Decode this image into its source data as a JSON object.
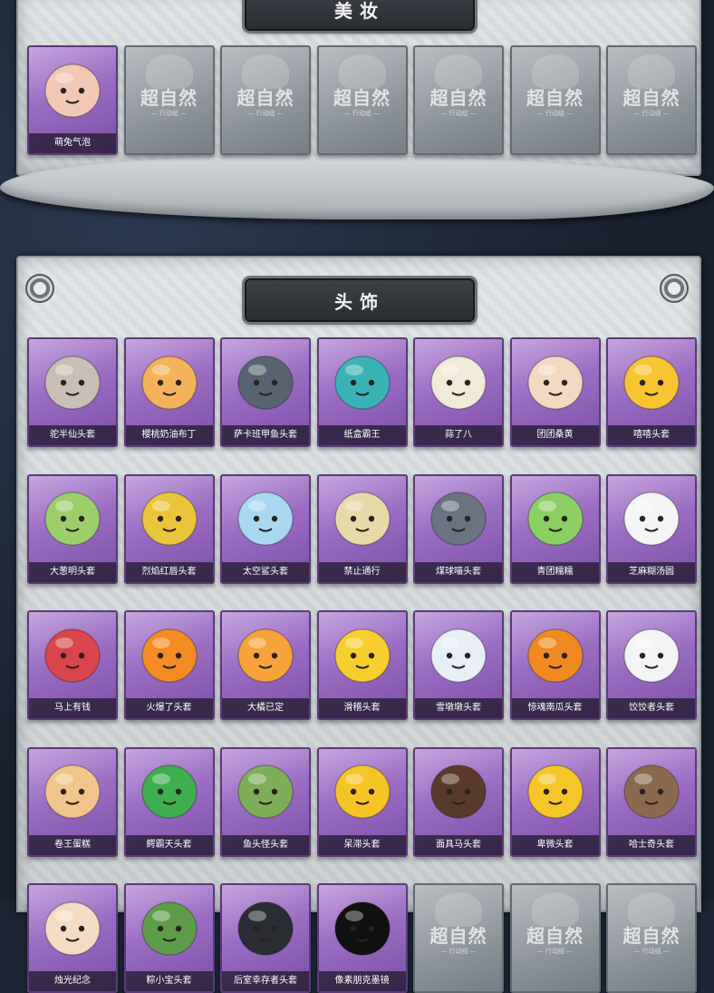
{
  "sections": {
    "makeup": {
      "title": "美妆",
      "items": [
        {
          "name": "萌兔气泡",
          "icon": "bunny-bubble-face-icon",
          "color": "#f2c7b3",
          "locked": false
        },
        {
          "name": "",
          "icon": "locked-placeholder-icon",
          "locked": true
        },
        {
          "name": "",
          "icon": "locked-placeholder-icon",
          "locked": true
        },
        {
          "name": "",
          "icon": "locked-placeholder-icon",
          "locked": true
        },
        {
          "name": "",
          "icon": "locked-placeholder-icon",
          "locked": true
        },
        {
          "name": "",
          "icon": "locked-placeholder-icon",
          "locked": true
        },
        {
          "name": "",
          "icon": "locked-placeholder-icon",
          "locked": true
        }
      ]
    },
    "headwear": {
      "title": "头饰",
      "items": [
        {
          "name": "驼半仙头套",
          "icon": "alpaca-sunglasses-head-icon",
          "color": "#c9bfb6",
          "locked": false
        },
        {
          "name": "樱桃奶油布丁",
          "icon": "cherry-pudding-head-icon",
          "color": "#f2b35a",
          "locked": false
        },
        {
          "name": "萨卡班甲鱼头套",
          "icon": "sacabambaspis-fish-head-icon",
          "color": "#5a6470",
          "locked": false
        },
        {
          "name": "纸盒霸王",
          "icon": "box-dinosaur-head-icon",
          "color": "#3ab3b7",
          "locked": false
        },
        {
          "name": "蒜了八",
          "icon": "garlic-head-icon",
          "color": "#f0ead8",
          "locked": false
        },
        {
          "name": "团团桑黄",
          "icon": "hamster-head-icon",
          "color": "#f4d8c0",
          "locked": false
        },
        {
          "name": "嘻嘻头套",
          "icon": "grinning-emoji-head-icon",
          "color": "#f7c531",
          "locked": false
        },
        {
          "name": "大葱明头套",
          "icon": "scallion-head-icon",
          "color": "#9ccf6a",
          "locked": false
        },
        {
          "name": "烈焰红唇头套",
          "icon": "pikachu-lips-head-icon",
          "color": "#e9c53a",
          "locked": false
        },
        {
          "name": "太空鲨头套",
          "icon": "space-shark-head-icon",
          "color": "#a9d7ef",
          "locked": false
        },
        {
          "name": "禁止通行",
          "icon": "traffic-cone-head-icon",
          "color": "#e8d9a8",
          "locked": false
        },
        {
          "name": "煤球喵头套",
          "icon": "gray-cat-head-icon",
          "color": "#6b7280",
          "locked": false
        },
        {
          "name": "青团糯糯",
          "icon": "green-rice-ball-head-icon",
          "color": "#8ccf63",
          "locked": false
        },
        {
          "name": "芝麻糊汤圆",
          "icon": "rice-dumpling-head-icon",
          "color": "#f5f5f7",
          "locked": false
        },
        {
          "name": "马上有钱",
          "icon": "red-horse-head-icon",
          "color": "#d8454a",
          "locked": false
        },
        {
          "name": "火爆了头套",
          "icon": "fire-sprite-head-icon",
          "color": "#f48b23",
          "locked": false
        },
        {
          "name": "大橘已定",
          "icon": "orange-slice-head-icon",
          "color": "#f6a33b",
          "locked": false
        },
        {
          "name": "滑稽头套",
          "icon": "funny-face-emoji-head-icon",
          "color": "#f6cf2f",
          "locked": false
        },
        {
          "name": "雪墩墩头套",
          "icon": "snowman-antlers-head-icon",
          "color": "#e8eef5",
          "locked": false
        },
        {
          "name": "惊魂南瓜头套",
          "icon": "pumpkin-head-icon",
          "color": "#ef8a22",
          "locked": false
        },
        {
          "name": "饺饺者头套",
          "icon": "dumpling-head-icon",
          "color": "#f4f4f4",
          "locked": false
        },
        {
          "name": "卷王蛋糕",
          "icon": "roll-cake-head-icon",
          "color": "#f0c58c",
          "locked": false
        },
        {
          "name": "鳄霸天头套",
          "icon": "crocodile-head-icon",
          "color": "#3fae4e",
          "locked": false
        },
        {
          "name": "鱼头怪头套",
          "icon": "fish-monster-head-icon",
          "color": "#7fae58",
          "locked": false
        },
        {
          "name": "呆滞头套",
          "icon": "dazed-emoji-head-icon",
          "color": "#f4c524",
          "locked": false
        },
        {
          "name": "面具马头套",
          "icon": "horse-mask-head-icon",
          "color": "#5a3a2a",
          "locked": false
        },
        {
          "name": "卑微头套",
          "icon": "humble-emoji-head-icon",
          "color": "#f5c62a",
          "locked": false
        },
        {
          "name": "哈士奇头套",
          "icon": "husky-sunglasses-head-icon",
          "color": "#8a6a4e",
          "locked": false
        },
        {
          "name": "烛光纪念",
          "icon": "candle-head-icon",
          "color": "#f3dcc3",
          "locked": false
        },
        {
          "name": "粽小宝头套",
          "icon": "zongzi-head-icon",
          "color": "#5f9c4a",
          "locked": false
        },
        {
          "name": "后室幸存者头套",
          "icon": "gas-mask-helmet-head-icon",
          "color": "#2a2d33",
          "locked": false
        },
        {
          "name": "像素朋克墨镜",
          "icon": "pixel-sunglasses-icon",
          "color": "#111111",
          "locked": false
        },
        {
          "name": "",
          "icon": "locked-placeholder-icon",
          "locked": true
        },
        {
          "name": "",
          "icon": "locked-placeholder-icon",
          "locked": true
        },
        {
          "name": "",
          "icon": "locked-placeholder-icon",
          "locked": true
        }
      ]
    },
    "locked_logo": {
      "text": "超自然",
      "sub": "— 行动组 —"
    }
  }
}
